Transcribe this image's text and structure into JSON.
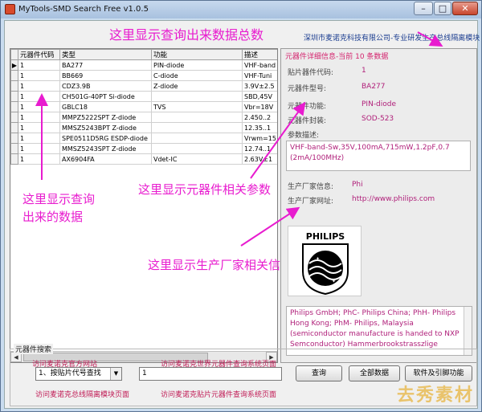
{
  "window": {
    "title": "MyTools-SMD Search Free v1.0.5",
    "minimize": "–",
    "maximize": "□",
    "close": "✕"
  },
  "annotations": {
    "top": "这里显示查询出来数据总数",
    "data": [
      "这里显示查询",
      "出来的数据"
    ],
    "params": "这里显示元器件相关参数",
    "maker": "这里显示生产厂家相关信息"
  },
  "company": "深圳市麦诺克科技有限公司-专业研发生产总线隔离模块",
  "grid": {
    "columns": [
      "元器件代码",
      "类型",
      "功能",
      "描述"
    ],
    "rows": [
      [
        "1",
        "BA277",
        "PIN-diode",
        "VHF-band"
      ],
      [
        "1",
        "BB669",
        "C-diode",
        "VHF-Tuni"
      ],
      [
        "1",
        "CDZ3.9B",
        "Z-diode",
        "3.9V±2.5"
      ],
      [
        "1",
        "CH501G-40PT Si-diode",
        "",
        "SBD,45V"
      ],
      [
        "1",
        "GBLC18",
        "TVS",
        "Vbr=18V"
      ],
      [
        "1",
        "MMPZ5222SPT Z-diode",
        "",
        "2.450..2"
      ],
      [
        "1",
        "MMSZ5243BPT Z-diode",
        "",
        "12.35..1"
      ],
      [
        "1",
        "SPE0511D5RG ESDP-diode",
        "",
        "Vrwm=15"
      ],
      [
        "1",
        "MMSZ5243SPT Z-diode",
        "",
        "12.74..1"
      ],
      [
        "1",
        "AX6904FA",
        "Vdet-IC",
        "2.63V±1"
      ]
    ]
  },
  "detail": {
    "header": "元器件详细信息-当前 10 条数据",
    "fields": {
      "code_label": "贴片器件代码:",
      "code": "1",
      "model_label": "元器件型号:",
      "model": "BA277",
      "function_label": "元器件功能:",
      "function": "PIN-diode",
      "package_label": "元器件封装:",
      "package": "SOD-523",
      "desc_label": "参数描述:",
      "desc": "VHF-band-Sw,35V,100mA,715mW,1.2pF,0.7 (2mA/100MHz)",
      "maker_label": "生产厂家信息:",
      "maker": "Phi",
      "site_label": "生产厂家网址:",
      "site": "http://www.philips.com",
      "maker_info": "Philips GmbH; PhC- Philips China; PhH- Philips Hong Kong; PhM- Philips, Malaysia (semiconductor manufacture is handed to NXP Semconductor) Hammerbrookstrasszlige"
    },
    "logo_text": "PHILIPS"
  },
  "search": {
    "group_title": "元器件搜索",
    "link_official": "访问麦诺克官方网站",
    "link_world": "访问麦诺克世界元器件查询系统页面",
    "link_bus": "访问麦诺克总线隔离模块页面",
    "link_smd": "访问麦诺克贴片元器件查询系统页面",
    "mode": "1、按贴片代号查找",
    "query": "1",
    "btn_search": "查询",
    "btn_all": "全部数据",
    "btn_about": "软件及引脚功能"
  },
  "watermark": "去秀素材"
}
